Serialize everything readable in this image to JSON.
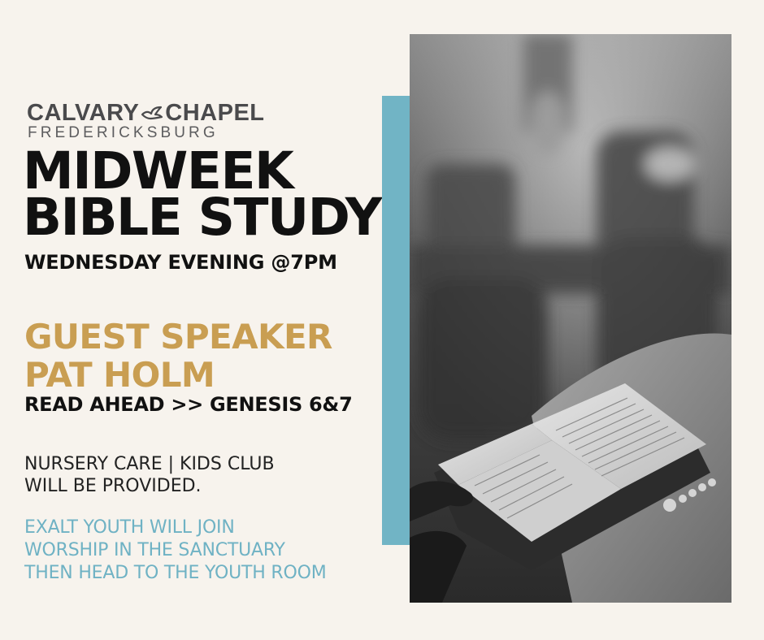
{
  "logo": {
    "word_left": "CALVARY",
    "word_right": "CHAPEL",
    "subtitle": "FREDERICKSBURG",
    "icon": "dove-icon"
  },
  "title": {
    "line1": "MIDWEEK",
    "line2": "BIBLE STUDY"
  },
  "schedule": "WEDNESDAY EVENING @7PM",
  "guest_speaker": {
    "line1": "GUEST SPEAKER",
    "line2": "PAT HOLM"
  },
  "read_ahead": "READ AHEAD >> GENESIS 6&7",
  "nursery": {
    "line1": "NURSERY CARE | KIDS CLUB",
    "line2": "WILL BE PROVIDED."
  },
  "youth": {
    "line1": "EXALT YOUTH WILL JOIN",
    "line2": "WORSHIP IN THE SANCTUARY",
    "line3": "THEN HEAD TO THE YOUTH ROOM"
  },
  "colors": {
    "background": "#f7f3ed",
    "title": "#111111",
    "gold": "#c99e52",
    "teal": "#71b4c5",
    "logo_gray": "#4a4a4c"
  },
  "photo": {
    "subject": "open-bible-photo"
  }
}
